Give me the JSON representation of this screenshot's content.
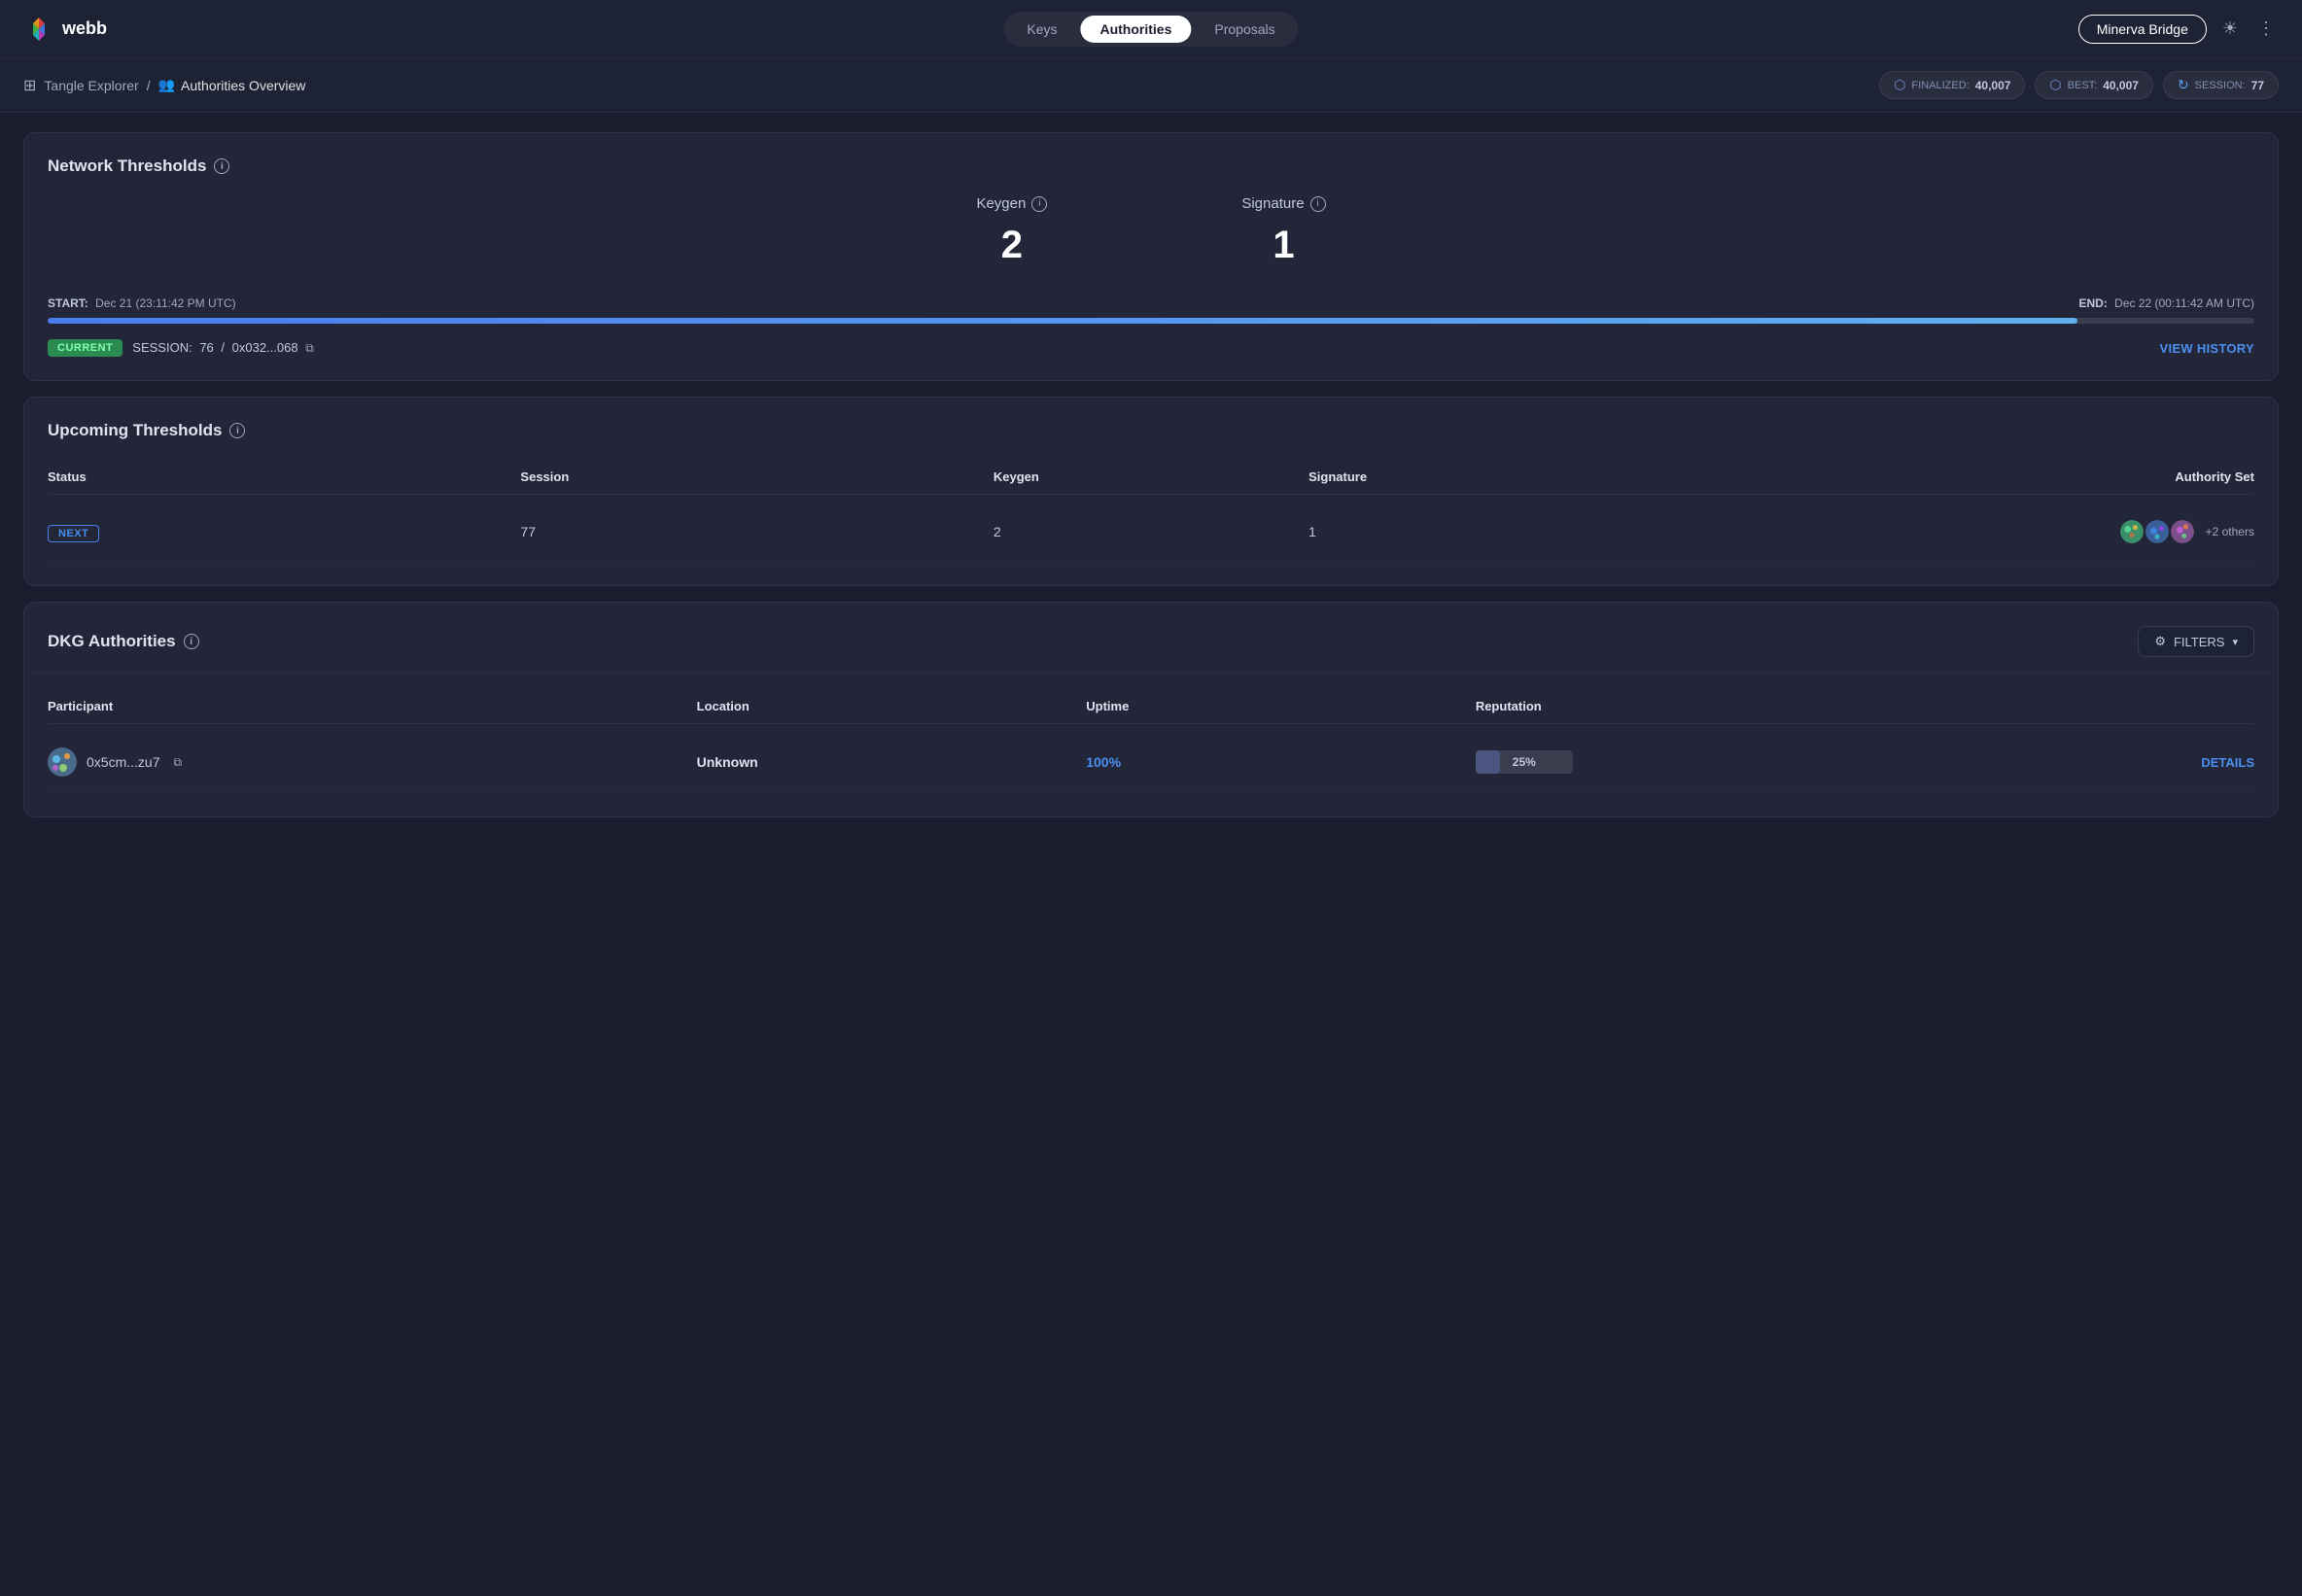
{
  "header": {
    "logo_text": "webb",
    "nav_tabs": [
      {
        "label": "Keys",
        "id": "keys",
        "active": false
      },
      {
        "label": "Authorities",
        "id": "authorities",
        "active": true
      },
      {
        "label": "Proposals",
        "id": "proposals",
        "active": false
      }
    ],
    "bridge_button": "Minerva Bridge",
    "theme_icon": "☀",
    "menu_icon": "⋮"
  },
  "breadcrumb": {
    "root_label": "Tangle Explorer",
    "separator": "/",
    "current_label": "Authorities Overview"
  },
  "stats": {
    "finalized_label": "FINALIZED:",
    "finalized_value": "40,007",
    "best_label": "BEST:",
    "best_value": "40,007",
    "session_label": "SESSION:",
    "session_value": "77"
  },
  "network_thresholds": {
    "title": "Network Thresholds",
    "keygen_label": "Keygen",
    "keygen_value": "2",
    "signature_label": "Signature",
    "signature_value": "1",
    "start_label": "START:",
    "start_date": "Dec 21 (23:11:42 PM UTC)",
    "end_label": "END:",
    "end_date": "Dec 22 (00:11:42 AM UTC)",
    "progress_percent": 92,
    "current_badge": "CURRENT",
    "session_label": "SESSION:",
    "session_number": "76",
    "session_separator": "/",
    "session_hash": "0x032...068",
    "view_history_label": "VIEW HISTORY"
  },
  "upcoming_thresholds": {
    "title": "Upcoming Thresholds",
    "columns": [
      "Status",
      "Session",
      "Keygen",
      "Signature",
      "Authority Set"
    ],
    "rows": [
      {
        "status": "NEXT",
        "session": "77",
        "keygen": "2",
        "signature": "1",
        "others_count": "+2 others"
      }
    ]
  },
  "dkg_authorities": {
    "title": "DKG Authorities",
    "filters_label": "FILTERS",
    "columns": [
      "Participant",
      "Location",
      "Uptime",
      "Reputation",
      ""
    ],
    "rows": [
      {
        "participant": "0x5cm...zu7",
        "location": "Unknown",
        "uptime": "100%",
        "reputation_value": "25%",
        "reputation_percent": 25,
        "details_label": "DETAILS"
      }
    ]
  }
}
